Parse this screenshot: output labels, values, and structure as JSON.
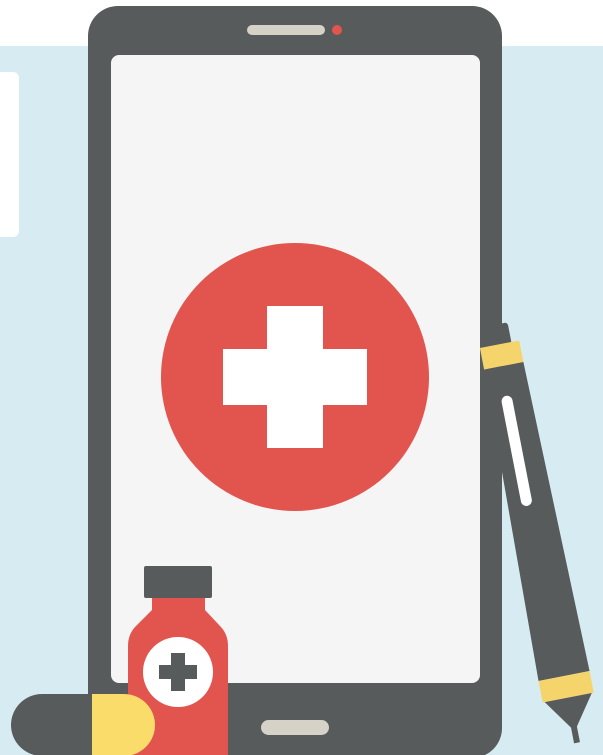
{
  "illustration": {
    "subject": "mobile-health-app",
    "icons": [
      "phone-icon",
      "medical-cross-icon",
      "medicine-bottle-icon",
      "pill-capsule-icon",
      "pen-icon"
    ]
  },
  "colors": {
    "background_panel": "#d7ecf2",
    "phone_body": "#575b5b",
    "phone_screen": "#f5f5f5",
    "speaker": "#d7d2c8",
    "camera_dot": "#e2544e",
    "accent_red": "#e2544e",
    "cross_white": "#ffffff",
    "pen_yellow": "#f5d56b",
    "pen_dark": "#575b5b",
    "capsule_yellow": "#fadc6a"
  }
}
